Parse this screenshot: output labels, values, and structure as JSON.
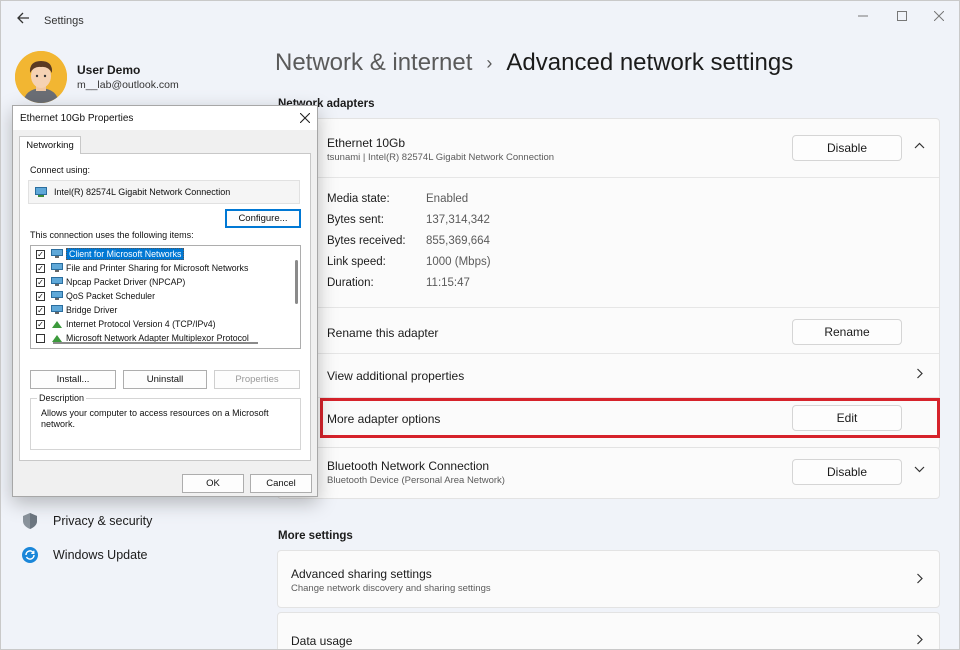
{
  "titlebar": {
    "back_icon": "arrow-left",
    "title": "Settings",
    "minimize_icon": "minimize",
    "maximize_icon": "maximize",
    "close_icon": "close"
  },
  "user": {
    "name": "User Demo",
    "email": "m__lab@outlook.com"
  },
  "sidebar": {
    "items": [
      {
        "label": "Privacy & security",
        "icon": "shield-icon"
      },
      {
        "label": "Windows Update",
        "icon": "update-icon"
      }
    ]
  },
  "breadcrumb": {
    "parent": "Network & internet",
    "separator": "›",
    "current": "Advanced network settings"
  },
  "network_adapters": {
    "heading": "Network adapters",
    "ethernet": {
      "name": "Ethernet 10Gb",
      "subtitle": "tsunami | Intel(R) 82574L Gigabit Network Connection",
      "action": "Disable",
      "expanded": true,
      "details": [
        {
          "label": "Media state:",
          "value": "Enabled"
        },
        {
          "label": "Bytes sent:",
          "value": "137,314,342"
        },
        {
          "label": "Bytes received:",
          "value": "855,369,664"
        },
        {
          "label": "Link speed:",
          "value": "1000 (Mbps)"
        },
        {
          "label": "Duration:",
          "value": "11:15:47"
        }
      ],
      "rename_label": "Rename this adapter",
      "rename_button": "Rename",
      "view_props_label": "View additional properties",
      "more_options_label": "More adapter options",
      "edit_button": "Edit"
    },
    "bluetooth": {
      "name": "Bluetooth Network Connection",
      "subtitle": "Bluetooth Device (Personal Area Network)",
      "action": "Disable"
    }
  },
  "more_settings": {
    "heading": "More settings",
    "items": [
      {
        "title": "Advanced sharing settings",
        "subtitle": "Change network discovery and sharing settings"
      },
      {
        "title": "Data usage",
        "subtitle": ""
      }
    ]
  },
  "dialog": {
    "title": "Ethernet 10Gb Properties",
    "tab": "Networking",
    "connect_using_label": "Connect using:",
    "adapter": "Intel(R) 82574L Gigabit Network Connection",
    "configure_button": "Configure...",
    "items_label": "This connection uses the following items:",
    "items": [
      {
        "label": "Client for Microsoft Networks",
        "checked": true,
        "selected": true
      },
      {
        "label": "File and Printer Sharing for Microsoft Networks",
        "checked": true,
        "selected": false
      },
      {
        "label": "Npcap Packet Driver (NPCAP)",
        "checked": true,
        "selected": false
      },
      {
        "label": "QoS Packet Scheduler",
        "checked": true,
        "selected": false
      },
      {
        "label": "Bridge Driver",
        "checked": true,
        "selected": false
      },
      {
        "label": "Internet Protocol Version 4 (TCP/IPv4)",
        "checked": true,
        "selected": false
      },
      {
        "label": "Microsoft Network Adapter Multiplexor Protocol",
        "checked": false,
        "selected": false
      }
    ],
    "install_button": "Install...",
    "uninstall_button": "Uninstall",
    "properties_button": "Properties",
    "description_label": "Description",
    "description_text": "Allows your computer to access resources on a Microsoft network.",
    "ok_button": "OK",
    "cancel_button": "Cancel"
  },
  "colors": {
    "highlight": "#d6232b",
    "selection": "#0078d4"
  }
}
